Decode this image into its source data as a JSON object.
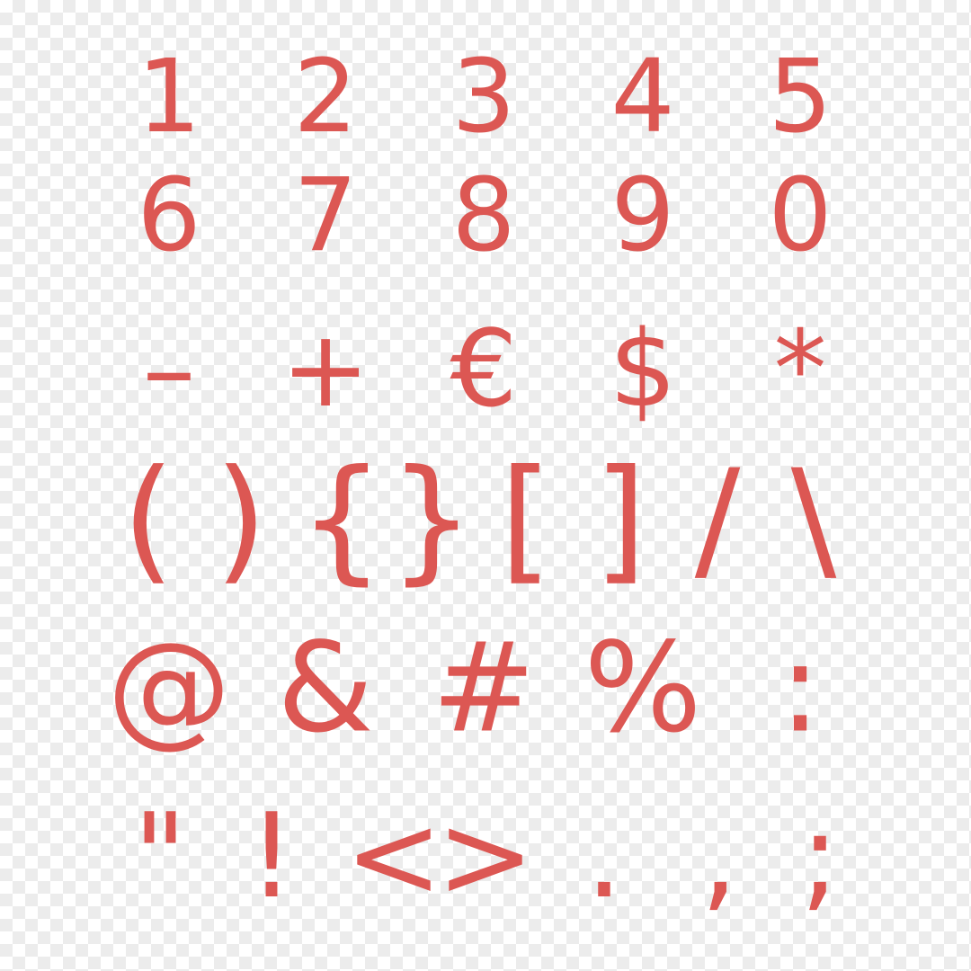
{
  "sheet": {
    "glyph_color": "#dc5753",
    "background": "transparent checkerboard",
    "rows": [
      [
        "1",
        "2",
        "3",
        "4",
        "5"
      ],
      [
        "6",
        "7",
        "8",
        "9",
        "0"
      ],
      [
        "–",
        "+",
        "€",
        "$",
        "*"
      ],
      [
        "(",
        ")",
        "{",
        "}",
        "[",
        "]",
        "/",
        "\\"
      ],
      [
        "@",
        "&",
        "#",
        "%",
        ":"
      ],
      [
        "\"",
        "!",
        "<",
        ">",
        ".",
        ",",
        ";"
      ]
    ]
  }
}
